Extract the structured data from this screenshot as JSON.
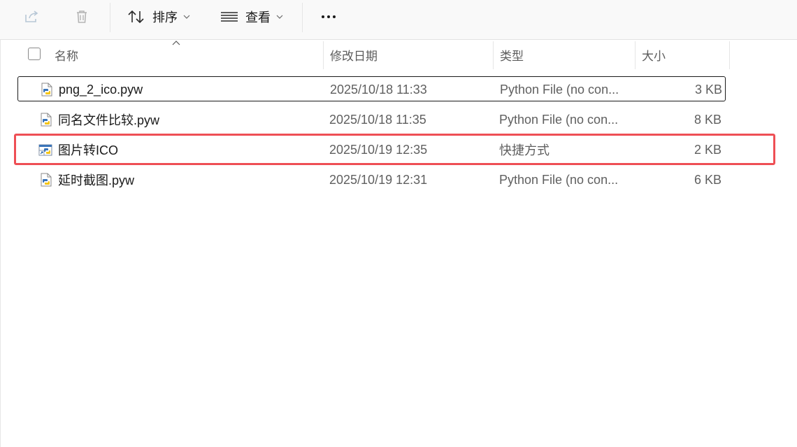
{
  "toolbar": {
    "share_icon": "share-icon",
    "delete_icon": "trash-icon",
    "sort_label": "排序",
    "view_label": "查看",
    "more_icon": "more-horizontal-icon"
  },
  "columns": {
    "name": "名称",
    "modified": "修改日期",
    "type": "类型",
    "size": "大小",
    "sort_indicator": "ascending"
  },
  "files": [
    {
      "name": "png_2_ico.pyw",
      "modified": "2025/10/18 11:33",
      "type": "Python File (no con...",
      "size": "3 KB",
      "icon": "python-file-icon",
      "focused": true
    },
    {
      "name": "同名文件比较.pyw",
      "modified": "2025/10/18 11:35",
      "type": "Python File (no con...",
      "size": "8 KB",
      "icon": "python-file-icon"
    },
    {
      "name": "图片转ICO",
      "modified": "2025/10/19 12:35",
      "type": "快捷方式",
      "size": "2 KB",
      "icon": "python-shortcut-icon",
      "highlighted": true
    },
    {
      "name": "延时截图.pyw",
      "modified": "2025/10/19 12:31",
      "type": "Python File (no con...",
      "size": "6 KB",
      "icon": "python-file-icon"
    }
  ],
  "colors": {
    "highlight_border": "#ee4f55",
    "python_blue": "#3a74b8",
    "python_yellow": "#f5c518"
  }
}
